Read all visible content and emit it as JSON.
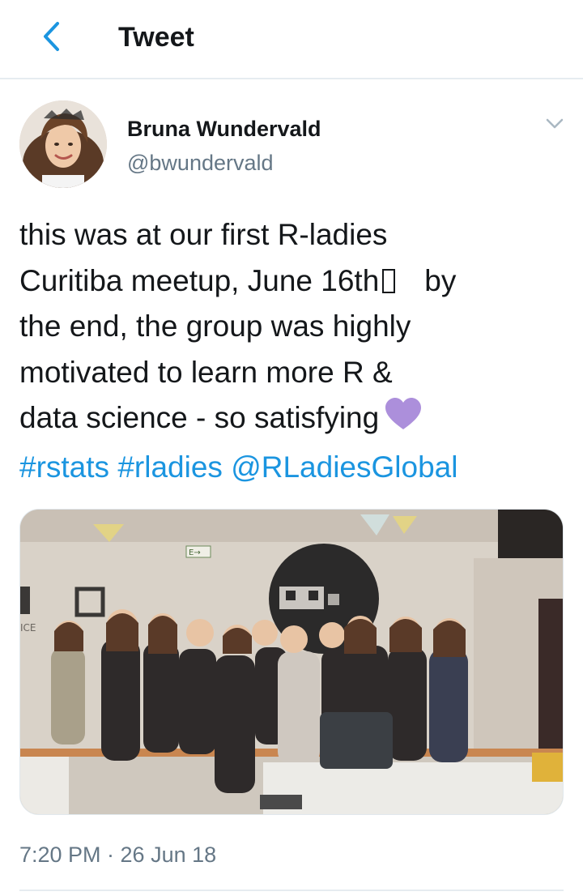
{
  "header": {
    "back_icon": "chevron-left-icon",
    "title": "Tweet"
  },
  "tweet": {
    "author": {
      "name": "Bruna Wundervald",
      "handle": "@bwundervald",
      "avatar_icon": "avatar-photo"
    },
    "menu_icon": "chevron-down-icon",
    "text": {
      "line1": "this was at our first R-ladies",
      "line2_a": "Curitiba meetup, June 16th",
      "line2_b": "by",
      "line3": "the end, the group was highly",
      "line4": "motivated to learn more R &",
      "line5": "data science - so satisfying",
      "hashtag1": "#rstats",
      "hashtag2": "#rladies",
      "mention": "@RLadiesGlobal"
    },
    "emoji_heart": "purple-heart-icon",
    "link_color": "#1b95e0",
    "heart_color": "#ac8fdb",
    "timestamp": "7:20 PM · 26 Jun 18"
  },
  "photo": {
    "exit_sign": "E→",
    "wall_text": "ICE"
  },
  "colors": {
    "text": "#14171a",
    "secondary": "#657786",
    "accent": "#1b95e0",
    "divider": "#e6ecf0"
  }
}
